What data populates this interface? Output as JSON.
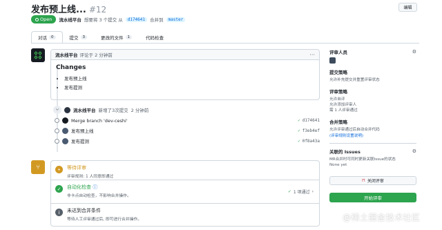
{
  "header": {
    "title": "发布预上线...",
    "number": "#12",
    "edit_label": "编辑",
    "status": "Open",
    "author": "流水线平台",
    "desc_before": "想要将 3 个提交 从",
    "source_branch": "d174641",
    "merge_to": "合并到",
    "target_branch": "master"
  },
  "tabs": [
    {
      "label": "对话",
      "count": "0"
    },
    {
      "label": "提交",
      "count": "3"
    },
    {
      "label": "更改的文件",
      "count": "1"
    },
    {
      "label": "代码检查",
      "count": ""
    }
  ],
  "comment": {
    "author": "流水线平台",
    "time": "评论于 2 分钟前",
    "heading": "Changes",
    "items": [
      "发布预上线",
      "发布提测"
    ]
  },
  "push": {
    "author": "流水线平台",
    "text": "新增了3次提交",
    "time": "2 分钟前"
  },
  "commits": [
    {
      "message": "Merge branch 'dev-ceshi'",
      "sha": "d174641"
    },
    {
      "message": "发布预上线",
      "sha": "f3eb4ef"
    },
    {
      "message": "发布提测",
      "sha": "0f8a43a"
    }
  ],
  "merge": {
    "waiting_title": "等待评审",
    "waiting_sub": "评审规则: 1 人同意即通过",
    "check_title": "自动化检查",
    "check_sub": "非卡点自动检查，不影响合并操作。",
    "check_result": "1 项通过",
    "unmet_title": "未达到合并条件",
    "unmet_sub": "等待人工评审通过后, 即可进行合并操作。"
  },
  "sidebar": {
    "reviewers_title": "评审人员",
    "commit_policy_title": "提交策略",
    "commit_policy_text": "允许补充提交并重置评审状态",
    "review_policy_title": "评审策略",
    "review_policy_lines": [
      "允许自评",
      "允许添加评审人",
      "需 1 人评审通过"
    ],
    "merge_policy_title": "合并策略",
    "merge_policy_text": "允许评审通过后自动合并代码",
    "rules_link": "(评审规则设置说明)",
    "issues_title": "关联的 Issues",
    "issues_text": "MR合并时可同时更新关联Issue的状态",
    "issues_none": "None yet",
    "close_label": "关闭评审",
    "review_label": "开始评审"
  },
  "watermark": "@稀土掘金技术社区",
  "colors": {
    "green": "#2da44e",
    "blue": "#0969da",
    "orange": "#d29922",
    "red": "#cf222e"
  }
}
